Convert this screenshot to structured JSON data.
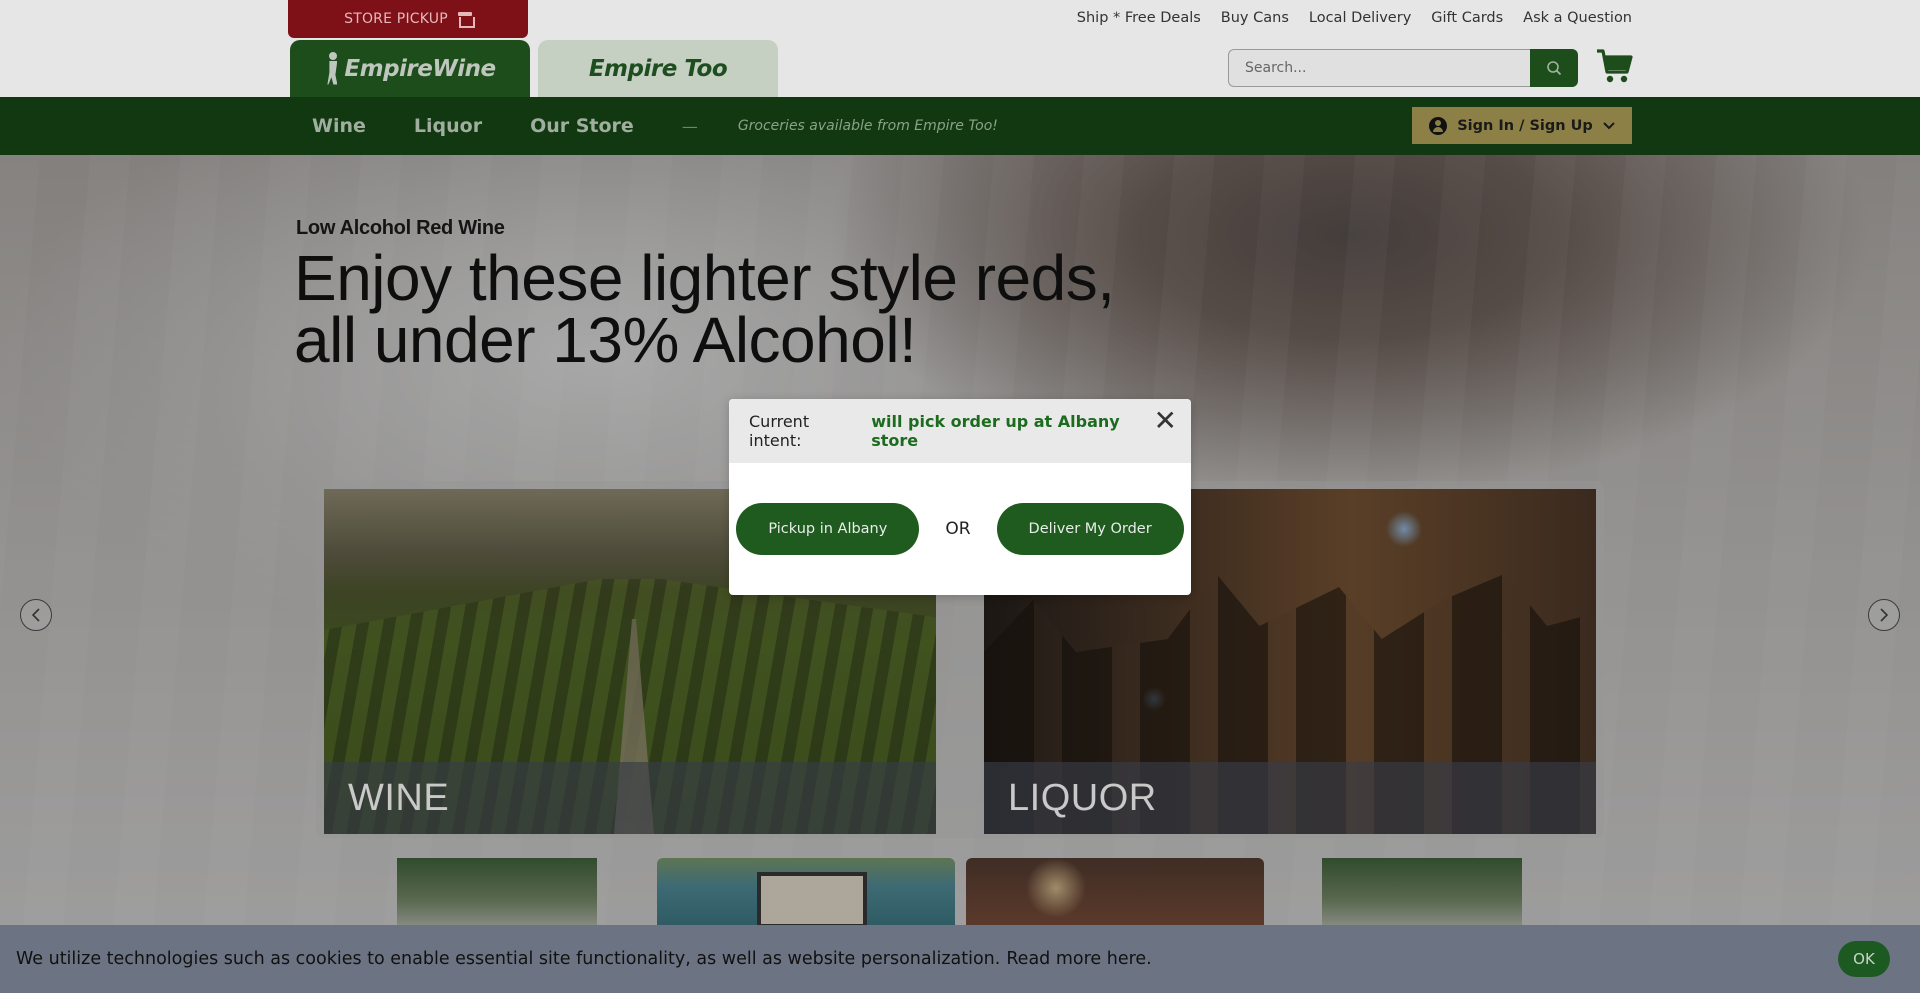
{
  "header": {
    "store_pickup_label": "STORE PICKUP",
    "top_links": [
      "Ship * Free Deals",
      "Buy Cans",
      "Local Delivery",
      "Gift Cards",
      "Ask a Question"
    ],
    "brand_primary": "EmpireWine",
    "brand_secondary": "Empire Too",
    "search_placeholder": "Search...",
    "icons": {
      "search": "search-icon",
      "cart": "cart-icon",
      "store": "store-icon"
    }
  },
  "nav": {
    "items": [
      "Wine",
      "Liquor",
      "Our Store"
    ],
    "separator": "—",
    "note": "Groceries available from Empire Too!",
    "signin_label": "Sign In / Sign Up"
  },
  "hero": {
    "subtitle": "Low Alcohol Red Wine",
    "title": "Enjoy these lighter style reds, all under 13% Alcohol!"
  },
  "categories": [
    {
      "label": "WINE"
    },
    {
      "label": "LIQUOR"
    }
  ],
  "modal": {
    "intent_prefix": "Current intent:",
    "intent_value": "will pick order up at Albany store",
    "close_glyph": "✕",
    "pickup_label": "Pickup in Albany",
    "or_label": "OR",
    "deliver_label": "Deliver My Order"
  },
  "cookie": {
    "text": "We utilize technologies such as cookies to enable essential site functionality, as well as website personalization.",
    "link": "Read more here.",
    "ok_label": "OK"
  },
  "colors": {
    "brand_green": "#1c4d1a",
    "nav_green": "#123811",
    "pickup_red": "#7d1117",
    "signin_gold": "#8c8046",
    "intent_green": "#1d6b1f"
  }
}
